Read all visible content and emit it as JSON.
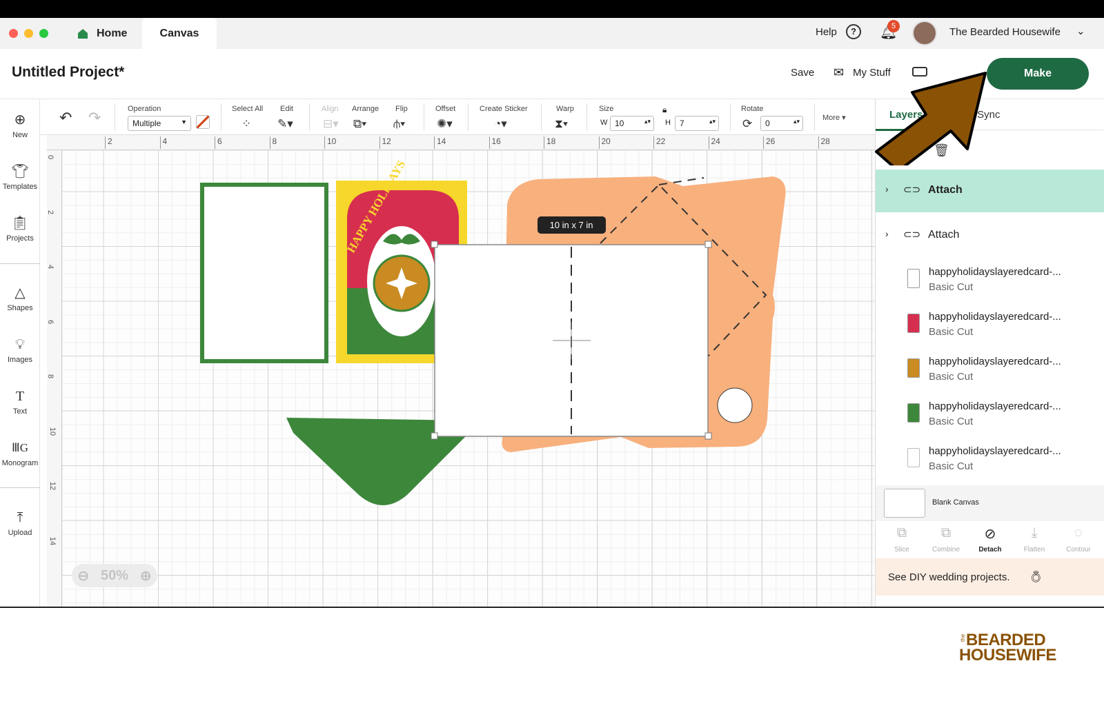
{
  "colors": {
    "accent": "#1e6a43",
    "arrow": "#8a5205",
    "selected_layer_bg": "#b8e8d8",
    "badge": "#e34b2b",
    "envelope": "#f8b07d",
    "card_green": "#3d873b",
    "card_yellow": "#f7d72b",
    "card_red": "#d62e4f"
  },
  "tabs": {
    "home": "Home",
    "canvas": "Canvas"
  },
  "header": {
    "help": "Help",
    "notifications_count": "5",
    "user_name": "The Bearded Housewife"
  },
  "titlebar": {
    "project_title": "Untitled Project*",
    "save": "Save",
    "my_stuff": "My Stuff",
    "make": "Make"
  },
  "sidebar": {
    "items": [
      {
        "label": "New",
        "icon": "plus-circle-icon"
      },
      {
        "label": "Templates",
        "icon": "shirt-icon"
      },
      {
        "label": "Projects",
        "icon": "clipboard-icon"
      },
      {
        "label": "Shapes",
        "icon": "shapes-icon"
      },
      {
        "label": "Images",
        "icon": "lightbulb-icon"
      },
      {
        "label": "Text",
        "icon": "text-icon"
      },
      {
        "label": "Monogram",
        "icon": "monogram-icon"
      },
      {
        "label": "Upload",
        "icon": "upload-icon"
      }
    ]
  },
  "toolbar": {
    "operation_label": "Operation",
    "operation_value": "Multiple",
    "select_all": "Select All",
    "edit": "Edit",
    "align": "Align",
    "arrange": "Arrange",
    "flip": "Flip",
    "offset": "Offset",
    "create_sticker": "Create Sticker",
    "warp": "Warp",
    "size": "Size",
    "w_label": "W",
    "w_value": "10",
    "h_label": "H",
    "h_value": "7",
    "rotate": "Rotate",
    "rotate_value": "0",
    "more": "More"
  },
  "rulers": {
    "top": [
      "2",
      "4",
      "6",
      "8",
      "10",
      "12",
      "14",
      "16",
      "18",
      "20",
      "22",
      "24",
      "26",
      "28"
    ],
    "left": [
      "0",
      "2",
      "4",
      "6",
      "8",
      "10",
      "12",
      "14"
    ]
  },
  "canvas": {
    "size_tooltip": "10 in x 7 in",
    "zoom": "50%",
    "card_text": "HAPPY HOLIDAYS"
  },
  "panel": {
    "tab_layers": "Layers",
    "tab_color_sync_partial": "olor Sync",
    "groups": [
      {
        "label": "Attach",
        "selected": true
      },
      {
        "label": "Attach",
        "selected": false
      }
    ],
    "layers": [
      {
        "name": "happyholidayslayeredcard-...",
        "sub": "Basic Cut"
      },
      {
        "name": "happyholidayslayeredcard-...",
        "sub": "Basic Cut"
      },
      {
        "name": "happyholidayslayeredcard-...",
        "sub": "Basic Cut"
      },
      {
        "name": "happyholidayslayeredcard-...",
        "sub": "Basic Cut"
      },
      {
        "name": "happyholidayslayeredcard-...",
        "sub": "Basic Cut"
      }
    ],
    "blank_canvas": "Blank Canvas",
    "ops": [
      "Slice",
      "Combine",
      "Detach",
      "Flatten",
      "Contour"
    ],
    "promo": "See DIY wedding projects."
  },
  "watermark": {
    "line1": "BEARDED",
    "line2": "HOUSEWIFE",
    "small": "the"
  }
}
